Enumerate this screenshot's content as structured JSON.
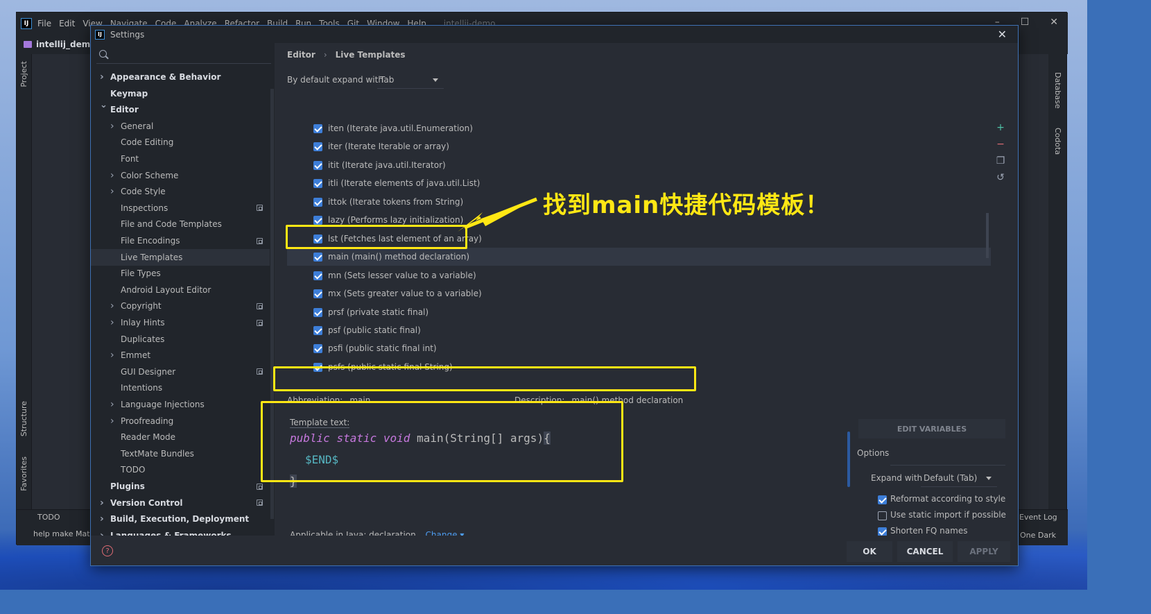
{
  "ide": {
    "menu": [
      "File",
      "Edit",
      "View",
      "Navigate",
      "Code",
      "Analyze",
      "Refactor",
      "Build",
      "Run",
      "Tools",
      "Git",
      "Window",
      "Help"
    ],
    "project_title": "intellij-demo",
    "project_name": "intellij_demo",
    "left_tools": {
      "project": "Project",
      "structure": "Structure",
      "favorites": "Favorites"
    },
    "right_tools": {
      "database": "Database",
      "codota": "Codota"
    },
    "bottom": {
      "todo": "TODO",
      "status": "help make Mat",
      "event_log": "Event Log",
      "theme": "One Dark"
    }
  },
  "dialog": {
    "title": "Settings",
    "tree": [
      {
        "label": "Appearance & Behavior",
        "bold": true,
        "arrow": "right",
        "indent": 0
      },
      {
        "label": "Keymap",
        "bold": true,
        "arrow": "",
        "indent": 0
      },
      {
        "label": "Editor",
        "bold": true,
        "arrow": "down",
        "indent": 0
      },
      {
        "label": "General",
        "bold": false,
        "arrow": "right",
        "indent": 1
      },
      {
        "label": "Code Editing",
        "bold": false,
        "arrow": "",
        "indent": 1
      },
      {
        "label": "Font",
        "bold": false,
        "arrow": "",
        "indent": 1
      },
      {
        "label": "Color Scheme",
        "bold": false,
        "arrow": "right",
        "indent": 1
      },
      {
        "label": "Code Style",
        "bold": false,
        "arrow": "right",
        "indent": 1
      },
      {
        "label": "Inspections",
        "bold": false,
        "arrow": "",
        "indent": 1,
        "copy": true
      },
      {
        "label": "File and Code Templates",
        "bold": false,
        "arrow": "",
        "indent": 1
      },
      {
        "label": "File Encodings",
        "bold": false,
        "arrow": "",
        "indent": 1,
        "copy": true
      },
      {
        "label": "Live Templates",
        "bold": false,
        "arrow": "",
        "indent": 1,
        "selected": true
      },
      {
        "label": "File Types",
        "bold": false,
        "arrow": "",
        "indent": 1
      },
      {
        "label": "Android Layout Editor",
        "bold": false,
        "arrow": "",
        "indent": 1
      },
      {
        "label": "Copyright",
        "bold": false,
        "arrow": "right",
        "indent": 1,
        "copy": true
      },
      {
        "label": "Inlay Hints",
        "bold": false,
        "arrow": "right",
        "indent": 1,
        "copy": true
      },
      {
        "label": "Duplicates",
        "bold": false,
        "arrow": "",
        "indent": 1
      },
      {
        "label": "Emmet",
        "bold": false,
        "arrow": "right",
        "indent": 1
      },
      {
        "label": "GUI Designer",
        "bold": false,
        "arrow": "",
        "indent": 1,
        "copy": true
      },
      {
        "label": "Intentions",
        "bold": false,
        "arrow": "",
        "indent": 1
      },
      {
        "label": "Language Injections",
        "bold": false,
        "arrow": "right",
        "indent": 1
      },
      {
        "label": "Proofreading",
        "bold": false,
        "arrow": "right",
        "indent": 1
      },
      {
        "label": "Reader Mode",
        "bold": false,
        "arrow": "",
        "indent": 1
      },
      {
        "label": "TextMate Bundles",
        "bold": false,
        "arrow": "",
        "indent": 1
      },
      {
        "label": "TODO",
        "bold": false,
        "arrow": "",
        "indent": 1
      },
      {
        "label": "Plugins",
        "bold": true,
        "arrow": "",
        "indent": 0,
        "copy": true
      },
      {
        "label": "Version Control",
        "bold": true,
        "arrow": "right",
        "indent": 0,
        "copy": true
      },
      {
        "label": "Build, Execution, Deployment",
        "bold": true,
        "arrow": "right",
        "indent": 0
      },
      {
        "label": "Languages & Frameworks",
        "bold": true,
        "arrow": "right",
        "indent": 0
      }
    ],
    "breadcrumb": {
      "parent": "Editor",
      "sep": "›",
      "current": "Live Templates"
    },
    "expand_label": "By default expand with",
    "expand_value": "Tab",
    "templates": [
      {
        "label": "iten (Iterate java.util.Enumeration)",
        "checked": true
      },
      {
        "label": "iter (Iterate Iterable or array)",
        "checked": true
      },
      {
        "label": "itit (Iterate java.util.Iterator)",
        "checked": true
      },
      {
        "label": "itli (Iterate elements of java.util.List)",
        "checked": true
      },
      {
        "label": "ittok (Iterate tokens from String)",
        "checked": true
      },
      {
        "label": "lazy (Performs lazy initialization)",
        "checked": true
      },
      {
        "label": "lst (Fetches last element of an array)",
        "checked": true
      },
      {
        "label": "main (main() method declaration)",
        "checked": true,
        "selected": true
      },
      {
        "label": "mn (Sets lesser value to a variable)",
        "checked": true
      },
      {
        "label": "mx (Sets greater value to a variable)",
        "checked": true
      },
      {
        "label": "prsf (private static final)",
        "checked": true
      },
      {
        "label": "psf (public static final)",
        "checked": true
      },
      {
        "label": "psfi (public static final int)",
        "checked": true
      },
      {
        "label": "psfs (public static final String)",
        "checked": true
      }
    ],
    "annotation": "找到main快捷代码模板！",
    "abbreviation_label": "Abbreviation:",
    "abbreviation_value": "main",
    "description_label": "Description:",
    "description_value": "main() method declaration",
    "template_text_label": "Template text:",
    "code": {
      "kw1": "public",
      "kw2": "static",
      "kw3": "void",
      "sig": "main(String[] args)",
      "open": "{",
      "end_var": "$END$",
      "close": "}"
    },
    "edit_variables": "EDIT VARIABLES",
    "options_title": "Options",
    "expand_with_label": "Expand with",
    "expand_with_value": "Default (Tab)",
    "opt_reformat": "Reformat according to style",
    "opt_static_import": "Use static import if possible",
    "opt_shorten": "Shorten FQ names",
    "opt_reformat_checked": true,
    "opt_static_import_checked": false,
    "opt_shorten_checked": true,
    "applicable": "Applicable in Java: declaration.",
    "change": "Change",
    "ok": "OK",
    "cancel": "CANCEL",
    "apply": "APPLY"
  },
  "colors": {
    "accent": "#3d7ed8",
    "highlight": "#ffe714",
    "keyword": "#c678dd",
    "variable": "#56b6c2",
    "link": "#4d9cf0"
  }
}
